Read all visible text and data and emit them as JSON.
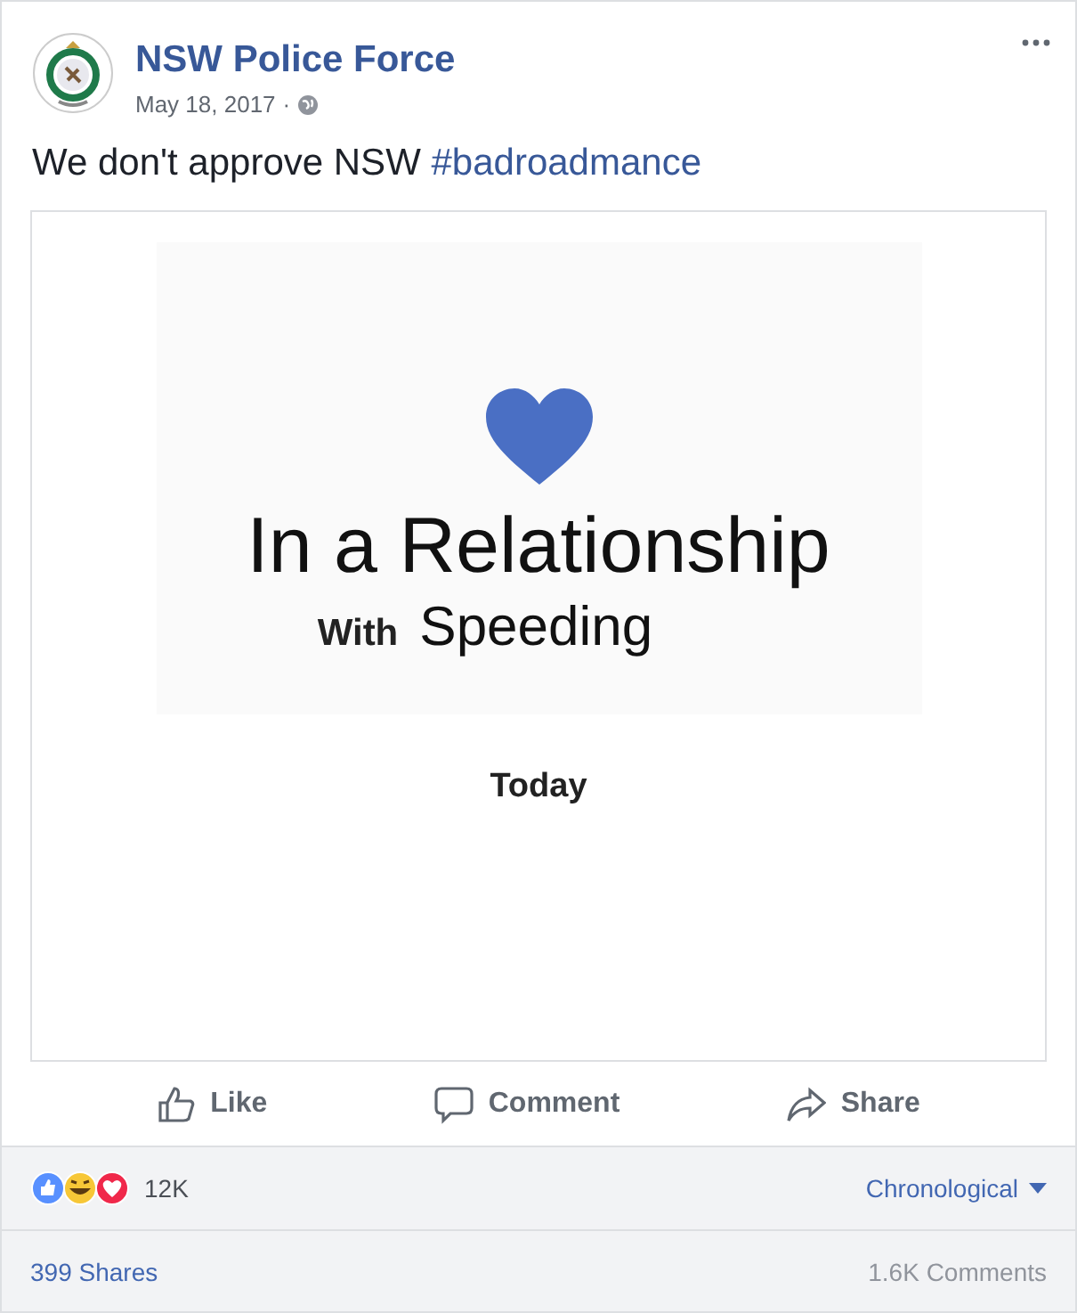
{
  "post": {
    "author": "NSW Police Force",
    "date": "May 18, 2017",
    "separator": "·",
    "text": "We don't approve NSW",
    "hashtag": "#badroadmance"
  },
  "shared_image": {
    "headline": "In a Relationship",
    "with": "With",
    "partner": "Speeding",
    "when": "Today"
  },
  "actions": [
    {
      "kind": "like",
      "label": "Like"
    },
    {
      "kind": "comment",
      "label": "Comment"
    },
    {
      "kind": "share",
      "label": "Share"
    }
  ],
  "reactions": {
    "count": "12K",
    "sort": "Chronological"
  },
  "footer": {
    "shares": "399 Shares",
    "comments": "1.6K Comments"
  }
}
